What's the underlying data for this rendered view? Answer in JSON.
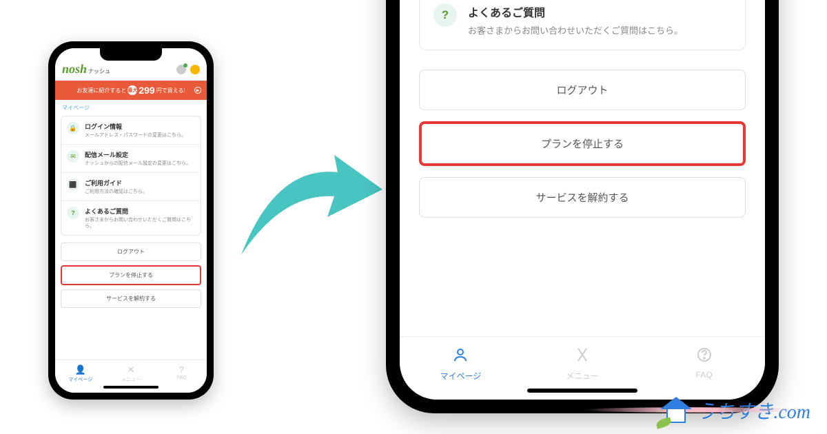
{
  "brand": {
    "logo_text": "nosh",
    "logo_jp": "ナッシュ"
  },
  "promo": {
    "prefix": "お友達に紹介すると",
    "disc": "最大",
    "price": "299",
    "suffix": "円で買える!"
  },
  "breadcrumb": "マイページ",
  "menu": {
    "login": {
      "title": "ログイン情報",
      "desc": "メールアドレス・パスワードの変更はこちら。"
    },
    "mail": {
      "title": "配信メール設定",
      "desc": "ナッシュからの配信メール設定の変更はこちら。"
    },
    "guide": {
      "title": "ご利用ガイド",
      "desc": "ご利用方法の確認はこちら。"
    },
    "faq": {
      "title": "よくあるご質問",
      "desc": "お客さまからお問い合わせいただくご質問はこちら。"
    }
  },
  "buttons": {
    "logout": "ログアウト",
    "stop": "プランを停止する",
    "cancel": "サービスを解約する"
  },
  "tabs": {
    "mypage": "マイページ",
    "menu": "メニュー",
    "faq": "FAQ"
  },
  "watermark": "うちすき.com"
}
